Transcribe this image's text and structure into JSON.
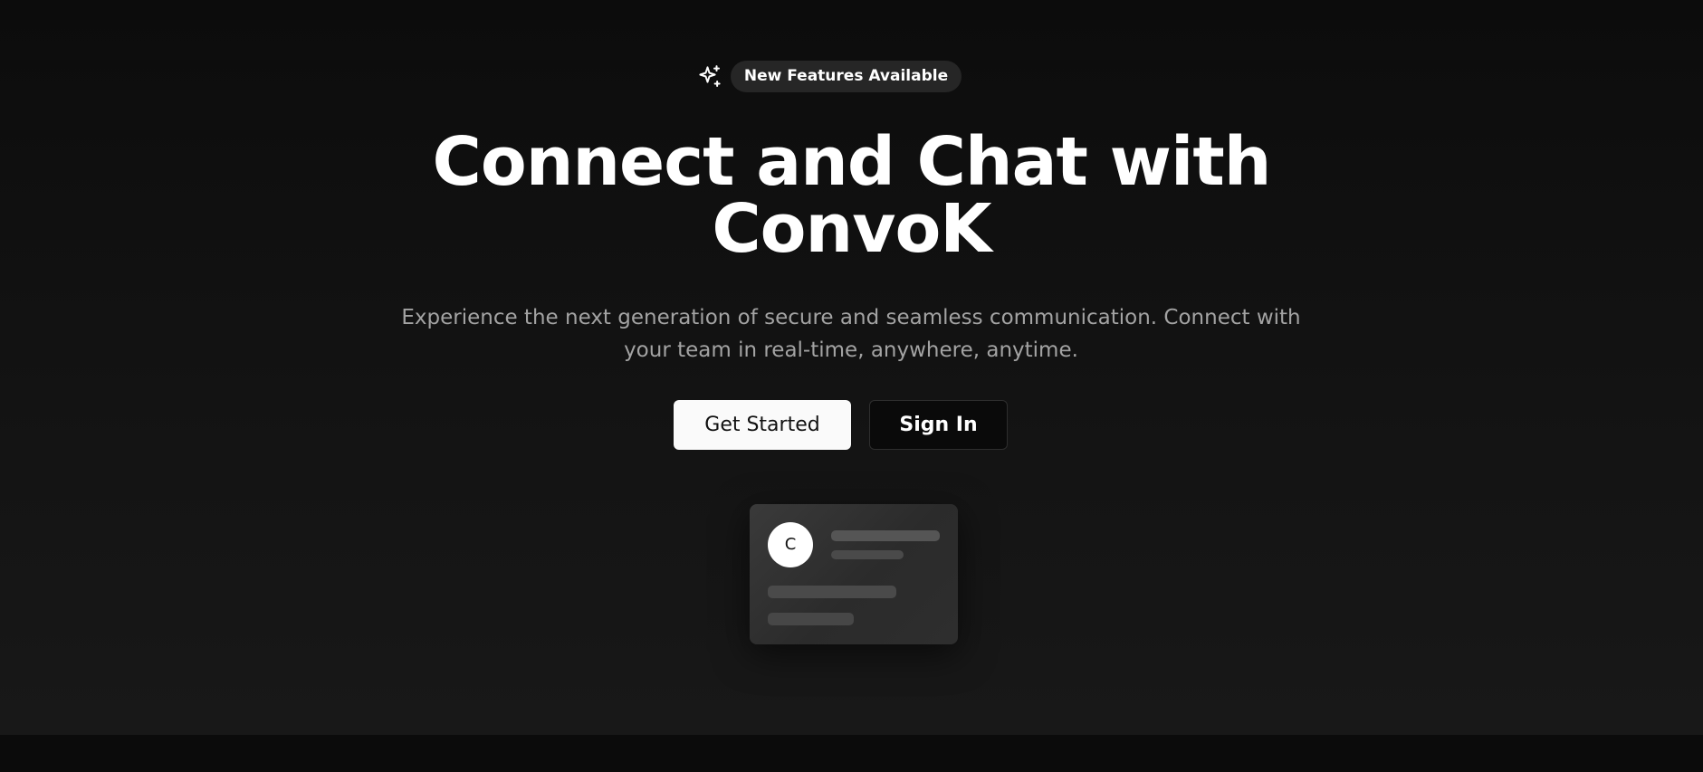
{
  "badge": {
    "icon": "sparkles-icon",
    "label": "New Features Available"
  },
  "hero": {
    "title_line1": "Connect and Chat with",
    "title_line2": "ConvoK",
    "subtitle": "Experience the next generation of secure and seamless communication. Connect with your team in real-time, anywhere, anytime."
  },
  "cta": {
    "primary_label": "Get Started",
    "secondary_label": "Sign In"
  },
  "preview": {
    "avatar_initial": "C"
  },
  "colors": {
    "background": "#0c0c0c",
    "text_primary": "#ffffff",
    "text_muted": "#a3a3a3",
    "badge_bg": "#262626",
    "button_primary_bg": "#fafafa"
  }
}
